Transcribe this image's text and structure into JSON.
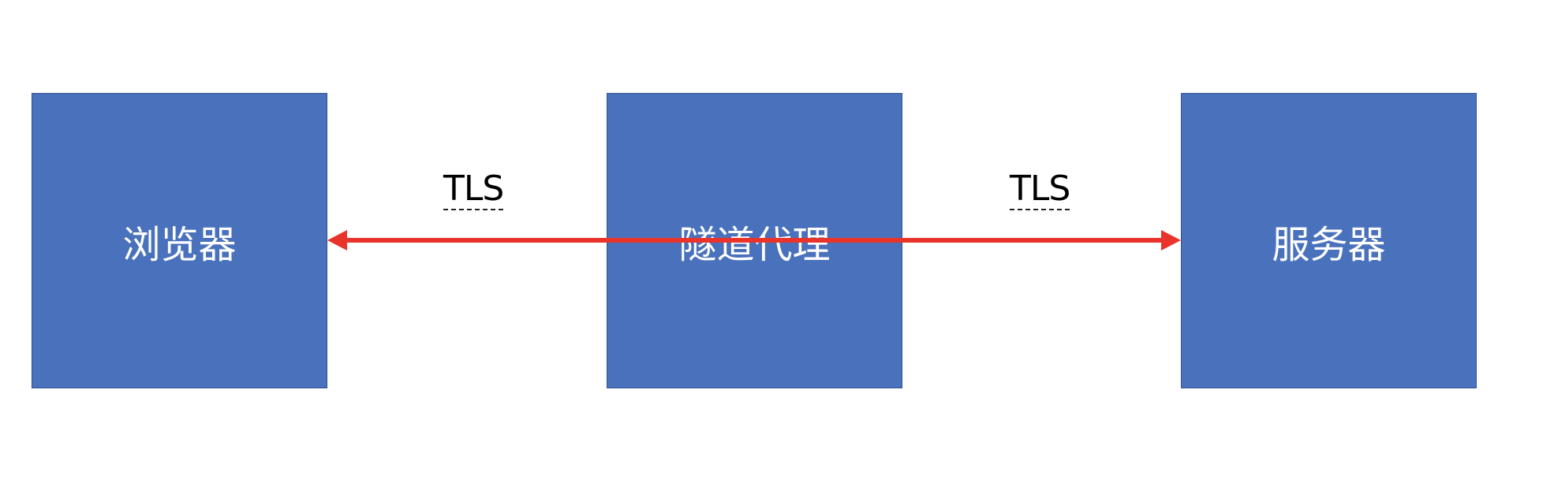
{
  "nodes": {
    "browser": "浏览器",
    "proxy": "隧道代理",
    "server": "服务器"
  },
  "links": {
    "left_label": "TLS",
    "right_label": "TLS"
  },
  "colors": {
    "node_fill": "#4a72bc",
    "node_border": "#2f528f",
    "arrow": "#e8342a",
    "node_text": "#ffffff"
  }
}
